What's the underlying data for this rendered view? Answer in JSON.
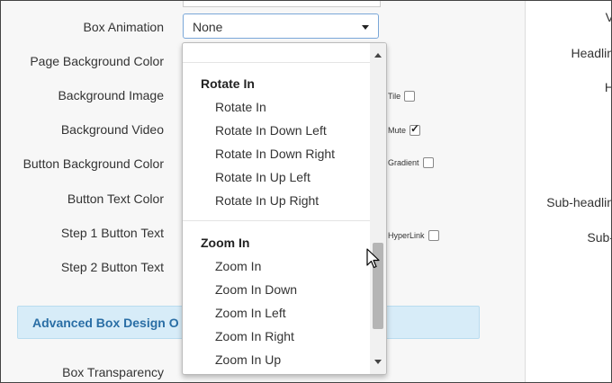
{
  "form": {
    "labels": {
      "box_animation": "Box Animation",
      "page_bg_color": "Page Background Color",
      "bg_image": "Background Image",
      "bg_video": "Background Video",
      "button_bg_color": "Button Background Color",
      "button_text_color": "Button Text Color",
      "step1_button_text": "Step 1 Button Text",
      "step2_button_text": "Step 2 Button Text",
      "box_transparency": "Box Transparency"
    },
    "box_animation_value": "None",
    "options": {
      "tile": "Tile",
      "mute": "Mute",
      "gradient": "Gradient",
      "hyperlink": "HyperLink"
    },
    "checks": {
      "tile": false,
      "mute": true,
      "gradient": false,
      "hyperlink": false
    },
    "advanced_section": "Advanced Box Design O"
  },
  "dropdown": {
    "groups": [
      {
        "label": "Rotate In",
        "items": [
          "Rotate In",
          "Rotate In Down Left",
          "Rotate In Down Right",
          "Rotate In Up Left",
          "Rotate In Up Right"
        ]
      },
      {
        "label": "Zoom In",
        "items": [
          "Zoom In",
          "Zoom In Down",
          "Zoom In Left",
          "Zoom In Right",
          "Zoom In Up"
        ]
      }
    ]
  },
  "right_panel": {
    "labels": [
      "V",
      "Headlin",
      "H",
      "Sub-headlin",
      "Sub-"
    ]
  },
  "icons": {
    "cursor": "mouse-pointer-icon",
    "caret": "caret-down-icon"
  }
}
